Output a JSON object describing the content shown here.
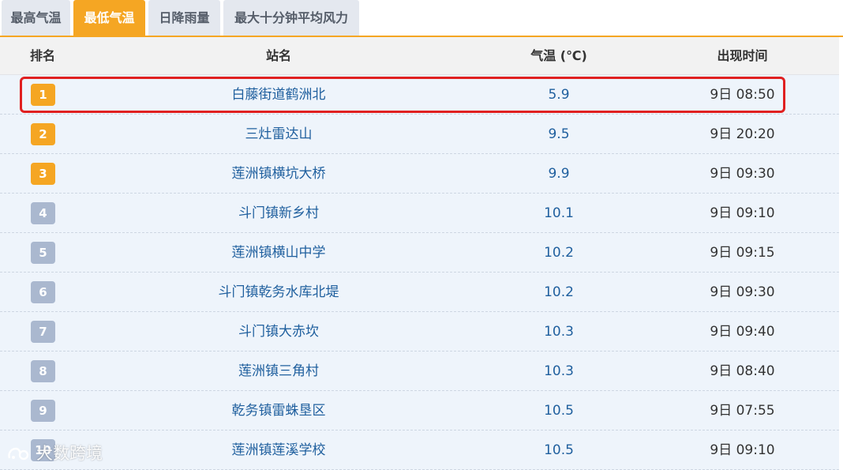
{
  "tabs": [
    {
      "label": "最高气温",
      "active": false
    },
    {
      "label": "最低气温",
      "active": true
    },
    {
      "label": "日降雨量",
      "active": false
    },
    {
      "label": "最大十分钟平均风力",
      "active": false
    }
  ],
  "table": {
    "headers": {
      "rank": "排名",
      "station": "站名",
      "temp": "气温 (℃)",
      "time": "出现时间"
    },
    "rows": [
      {
        "rank": "1",
        "station": "白藤街道鹤洲北",
        "temp": "5.9",
        "time": "9日 08:50"
      },
      {
        "rank": "2",
        "station": "三灶雷达山",
        "temp": "9.5",
        "time": "9日 20:20"
      },
      {
        "rank": "3",
        "station": "莲洲镇横坑大桥",
        "temp": "9.9",
        "time": "9日 09:30"
      },
      {
        "rank": "4",
        "station": "斗门镇新乡村",
        "temp": "10.1",
        "time": "9日 09:10"
      },
      {
        "rank": "5",
        "station": "莲洲镇横山中学",
        "temp": "10.2",
        "time": "9日 09:15"
      },
      {
        "rank": "6",
        "station": "斗门镇乾务水库北堤",
        "temp": "10.2",
        "time": "9日 09:30"
      },
      {
        "rank": "7",
        "station": "斗门镇大赤坎",
        "temp": "10.3",
        "time": "9日 09:40"
      },
      {
        "rank": "8",
        "station": "莲洲镇三角村",
        "temp": "10.3",
        "time": "9日 08:40"
      },
      {
        "rank": "9",
        "station": "乾务镇雷蛛垦区",
        "temp": "10.5",
        "time": "9日 07:55"
      },
      {
        "rank": "10",
        "station": "莲洲镇莲溪学校",
        "temp": "10.5",
        "time": "9日 09:10"
      }
    ]
  },
  "watermark": {
    "text": "大数跨境"
  },
  "colors": {
    "accent": "#f5a623",
    "badge_default": "#aab8cf",
    "row_bg": "#eef4fb",
    "link_text": "#1f5f9e",
    "highlight": "#e02020"
  }
}
